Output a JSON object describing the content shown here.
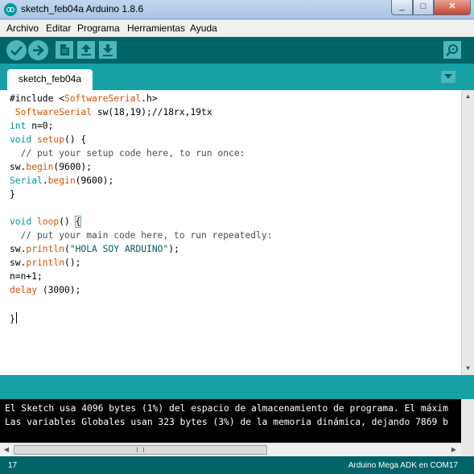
{
  "window": {
    "title": "sketch_feb04a Arduino 1.8.6",
    "minimize_glyph": "_",
    "maximize_glyph": "□",
    "close_glyph": "✕"
  },
  "menu": [
    "Archivo",
    "Editar",
    "Programa",
    "Herramientas",
    "Ayuda"
  ],
  "toolbar": {
    "buttons": [
      "verify-icon",
      "upload-icon",
      "new-icon",
      "open-icon",
      "save-icon"
    ],
    "serial_monitor": "serial-monitor-icon"
  },
  "tab": {
    "label": "sketch_feb04a"
  },
  "code": {
    "l1_pre": "#include <",
    "l1_lib": "SoftwareSerial",
    "l1_post": ".h>",
    "l2_type": " SoftwareSerial",
    "l2_rest": " sw(18,19);//18rx,19tx",
    "l3_kw": "int",
    "l3_rest": " n=0;",
    "l4_kw": "void",
    "l4_fn": " setup",
    "l4_rest": "() {",
    "l5": "  // put your setup code here, to run once:",
    "l6_obj": "sw.",
    "l6_fn": "begin",
    "l6_rest": "(9600);",
    "l7_obj": "Serial",
    "l7_dot": ".",
    "l7_fn": "begin",
    "l7_rest": "(9600);",
    "l8": "}",
    "l10_kw": "void",
    "l10_fn": " loop",
    "l10_rest": "() ",
    "l10_brace": "{",
    "l11": "  // put your main code here, to run repeatedly:",
    "l12_obj": "sw.",
    "l12_fn": "println",
    "l12_open": "(",
    "l12_str": "\"HOLA SOY ARDUINO\"",
    "l12_close": ");",
    "l13_obj": "sw.",
    "l13_fn": "println",
    "l13_rest": "();",
    "l14": "n=n+1;",
    "l15_fn": "delay",
    "l15_rest": " (3000);",
    "l17": "}"
  },
  "console": {
    "line1": "El Sketch usa 4096 bytes (1%) del espacio de almacenamiento de programa. El máxim",
    "line2": "Las variables Globales usan 323 bytes (3%) de la memoria dinámica, dejando 7869 b"
  },
  "footer": {
    "line_number": "17",
    "board": "Arduino Mega ADK en COM17"
  }
}
